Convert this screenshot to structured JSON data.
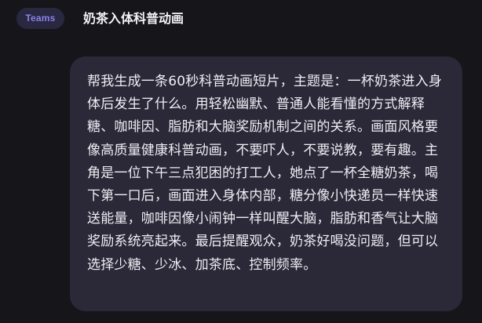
{
  "header": {
    "badge_label": "Teams",
    "title": "奶茶入体科普动画"
  },
  "message": {
    "text": "帮我生成一条60秒科普动画短片，主题是：一杯奶茶进入身体后发生了什么。用轻松幽默、普通人能看懂的方式解释糖、咖啡因、脂肪和大脑奖励机制之间的关系。画面风格要像高质量健康科普动画，不要吓人，不要说教，要有趣。主角是一位下午三点犯困的打工人，她点了一杯全糖奶茶，喝下第一口后，画面进入身体内部，糖分像小快递员一样快速送能量，咖啡因像小闹钟一样叫醒大脑，脂肪和香气让大脑奖励系统亮起来。最后提醒观众，奶茶好喝没问题，但可以选择少糖、少冰、加茶底、控制频率。"
  },
  "colors": {
    "background": "#16151a",
    "bubble": "#2b2838",
    "badge_bg": "#2a2740",
    "badge_text": "#8b82e8",
    "text": "#efeef3"
  }
}
